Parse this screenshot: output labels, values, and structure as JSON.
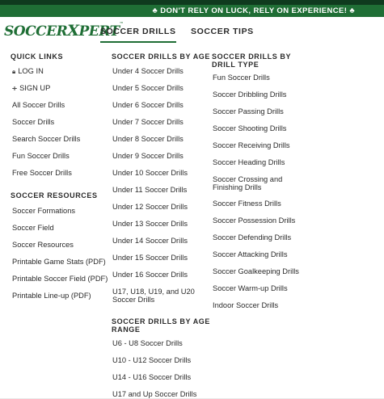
{
  "banner": {
    "text": "♣ DON'T RELY ON LUCK, RELY ON EXPERIENCE! ♣"
  },
  "header": {
    "logo_pre": "SOCCER",
    "logo_x": "X",
    "logo_post": "PERT",
    "logo_tm": "™",
    "tabs": [
      "SOCCER DRILLS",
      "SOCCER TIPS"
    ]
  },
  "quick_links": {
    "heading": "QUICK LINKS",
    "login": "LOG IN",
    "signup": "SIGN UP",
    "items": [
      "All Soccer Drills",
      "Soccer Drills",
      "Search Soccer Drills",
      "Fun Soccer Drills",
      "Free Soccer Drills"
    ]
  },
  "soccer_resources": {
    "heading": "SOCCER RESOURCES",
    "items": [
      "Soccer Formations",
      "Soccer Field",
      "Soccer Resources",
      "Printable Game Stats (PDF)",
      "Printable Soccer Field (PDF)",
      "Printable Line-up (PDF)"
    ]
  },
  "drills_by_age": {
    "heading": "SOCCER DRILLS BY AGE",
    "items": [
      "Under 4 Soccer Drills",
      "Under 5 Soccer Drills",
      "Under 6 Soccer Drills",
      "Under 7 Soccer Drills",
      "Under 8 Soccer Drills",
      "Under 9 Soccer Drills",
      "Under 10 Soccer Drills",
      "Under 11 Soccer Drills",
      "Under 12 Soccer Drills",
      "Under 13 Soccer Drills",
      "Under 14 Soccer Drills",
      "Under 15 Soccer Drills",
      "Under 16 Soccer Drills"
    ],
    "last_line1": "U17, U18, U19, and U20",
    "last_line2": "Soccer Drills"
  },
  "drills_by_age_range": {
    "heading_line1": "SOCCER DRILLS BY AGE",
    "heading_line2": "RANGE",
    "items": [
      "U6 - U8 Soccer Drills",
      "U10 - U12 Soccer Drills",
      "U14 - U16 Soccer Drills",
      "U17 and Up Soccer Drills"
    ]
  },
  "drills_by_type": {
    "heading_line1": "SOCCER DRILLS BY",
    "heading_line2": "DRILL TYPE",
    "items_a": [
      "Fun Soccer Drills",
      "Soccer Dribbling Drills",
      "Soccer Passing Drills",
      "Soccer Shooting Drills",
      "Soccer Receiving Drills",
      "Soccer Heading Drills"
    ],
    "crossing_line1": "Soccer Crossing and",
    "crossing_line2": "Finishing Drills",
    "items_b": [
      "Soccer Fitness Drills",
      "Soccer Possession Drills",
      "Soccer Defending Drills",
      "Soccer Attacking Drills",
      "Soccer Goalkeeping Drills",
      "Soccer Warm-up Drills",
      "Indoor Soccer Drills"
    ]
  },
  "colors": {
    "brand_green": "#1f6e35",
    "top_strip": "#0f3a1e"
  }
}
